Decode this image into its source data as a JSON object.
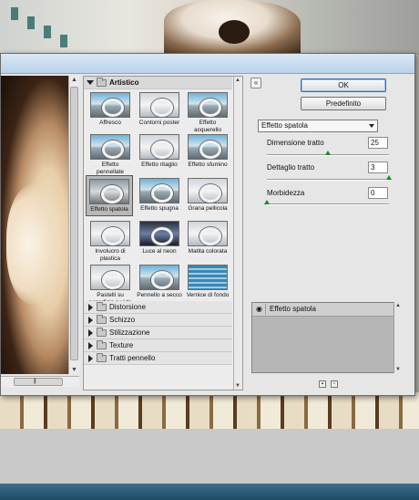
{
  "gallery": {
    "open_category": "Artistico",
    "filters": [
      {
        "label": "Affresco"
      },
      {
        "label": "Contorni poster"
      },
      {
        "label": "Effetto acquerello"
      },
      {
        "label": "Effetto pennellate"
      },
      {
        "label": "Effetto ritaglio"
      },
      {
        "label": "Effetto sfumino"
      },
      {
        "label": "Effetto spatola"
      },
      {
        "label": "Effetto spugna"
      },
      {
        "label": "Grana pellicola"
      },
      {
        "label": "Involucro di plastica"
      },
      {
        "label": "Luce al neon"
      },
      {
        "label": "Matita colorata"
      },
      {
        "label": "Pastelli su superficie ruvida"
      },
      {
        "label": "Pennello a secco"
      },
      {
        "label": "Vernice di fondo"
      }
    ],
    "selected_filter": "Effetto spatola",
    "categories": [
      "Distorsione",
      "Schizzo",
      "Stilizzazione",
      "Texture",
      "Tratti pennello"
    ]
  },
  "buttons": {
    "ok": "OK",
    "default": "Predefinito",
    "collapse": "«"
  },
  "settings": {
    "filter_select": "Effetto spatola",
    "params": [
      {
        "label": "Dimensione tratto",
        "value": "25",
        "fraction": 0.5
      },
      {
        "label": "Dettaglio tratto",
        "value": "3",
        "fraction": 1.0
      },
      {
        "label": "Morbidezza",
        "value": "0",
        "fraction": 0.0
      }
    ]
  },
  "effects": {
    "layers": [
      {
        "name": "Effetto spatola"
      }
    ],
    "visibility_icon": "eye-icon"
  },
  "colors": {
    "slider_knob": "#1e8a1e",
    "ok_border": "#2f6fb3"
  }
}
